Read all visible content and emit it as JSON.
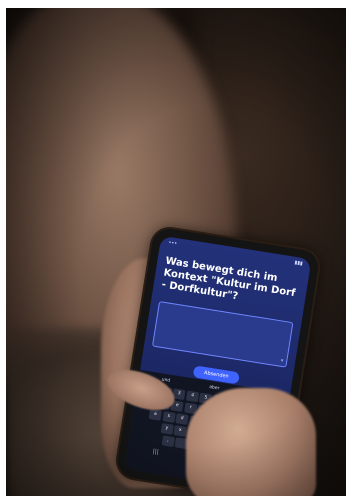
{
  "photo": {
    "subject": "person-holding-smartphone"
  },
  "phone_screen": {
    "question": "Was bewegt dich im Kontext \"Kultur im Dorf - Dorfkultur\"?",
    "answer_placeholder": "",
    "submit_label": "Absenden",
    "footer_text": ""
  },
  "keyboard": {
    "suggestions": [
      "und",
      "aber",
      "hab"
    ],
    "rows": [
      [
        "1",
        "2",
        "3",
        "4",
        "5",
        "6",
        "7",
        "8",
        "9",
        "0"
      ],
      [
        "q",
        "w",
        "e",
        "r",
        "t",
        "z",
        "u",
        "i",
        "o",
        "p"
      ],
      [
        "a",
        "s",
        "d",
        "f",
        "g",
        "h",
        "j",
        "k",
        "l"
      ],
      [
        "y",
        "x",
        "c",
        "v",
        "b",
        "n",
        "m"
      ]
    ]
  },
  "colors": {
    "screen": "#23317a",
    "button": "#3f63ff",
    "background": "#1c1511"
  }
}
